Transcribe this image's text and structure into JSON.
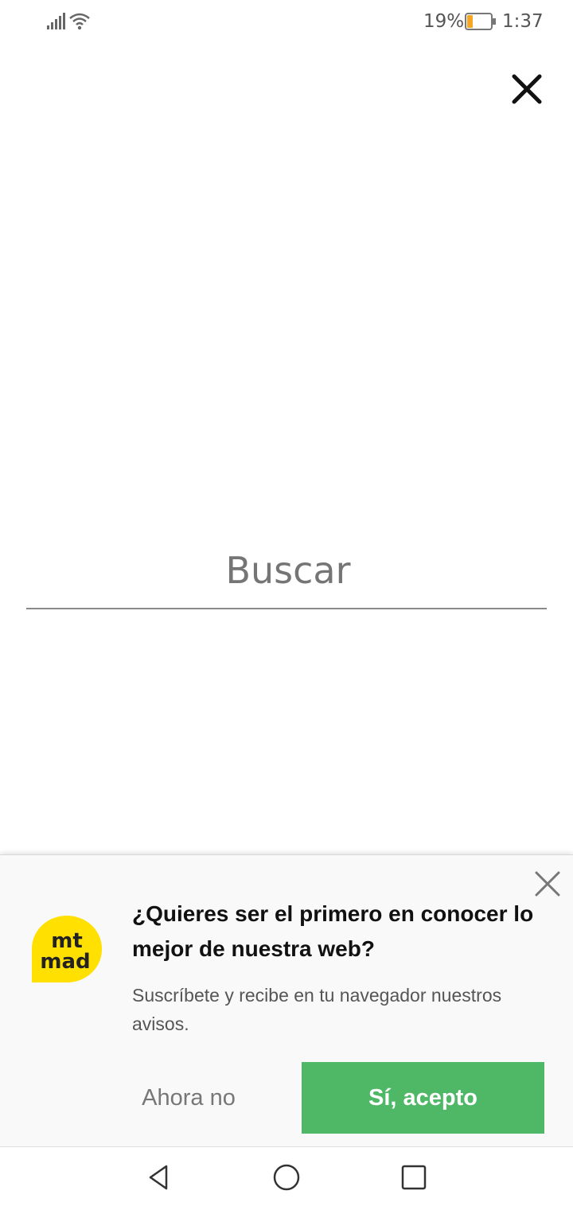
{
  "status_bar": {
    "battery_percent": "19%",
    "battery_level": 0.19,
    "battery_color": "#f5a623",
    "time": "1:37",
    "icons": [
      "signal-icon",
      "wifi-icon",
      "battery-icon"
    ]
  },
  "search": {
    "placeholder": "Buscar",
    "value": "",
    "close_icon": "close-icon"
  },
  "subscribe_prompt": {
    "logo_text_line1": "mt",
    "logo_text_line2": "mad",
    "logo_color": "#ffe000",
    "title": "¿Quieres ser el primero en conocer lo mejor de nuestra web?",
    "body": "Suscríbete y recibe en tu navegador nuestros avisos.",
    "decline_label": "Ahora no",
    "accept_label": "Sí, acepto",
    "accept_color": "#4fb867",
    "close_icon": "close-icon"
  },
  "nav_bar": {
    "icons": [
      "back-icon",
      "home-icon",
      "recent-apps-icon"
    ]
  }
}
